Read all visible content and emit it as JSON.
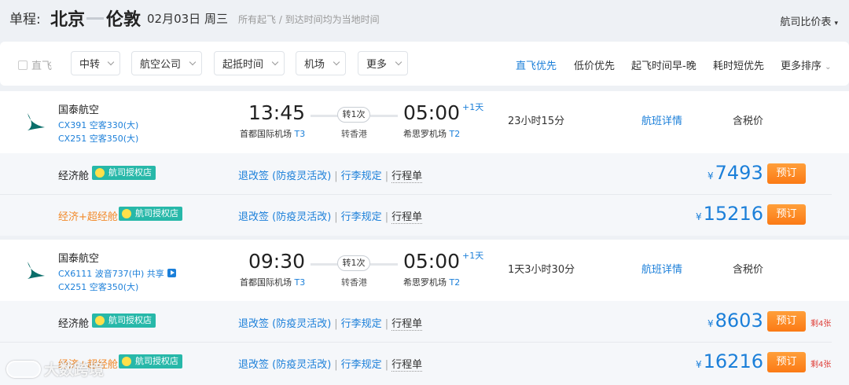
{
  "header": {
    "trip_type": "单程:",
    "from": "北京",
    "to": "伦敦",
    "date": "02月03日 周三",
    "note": "所有起飞 / 到达时间均为当地时间",
    "compare": "航司比价表"
  },
  "filters": {
    "direct_label": "直飞",
    "dropdowns": [
      "中转",
      "航空公司",
      "起抵时间",
      "机场",
      "更多"
    ],
    "sorts": [
      "直飞优先",
      "低价优先",
      "起飞时间早-晚",
      "耗时短优先",
      "更多排序"
    ],
    "active_sort": "直飞优先"
  },
  "flights": [
    {
      "airline": "国泰航空",
      "leg1": "CX391 空客330(大)",
      "leg2": "CX251 空客350(大)",
      "dep_time": "13:45",
      "dep_airport": "首都国际机场",
      "dep_terminal": "T3",
      "stops": "转1次",
      "via": "转香港",
      "arr_time": "05:00",
      "arr_airport": "希思罗机场",
      "arr_terminal": "T2",
      "day_offset": "+1天",
      "duration": "23小时15分",
      "detail": "航班详情",
      "tax": "含税价",
      "fares": [
        {
          "cabin": "经济舱",
          "badge": "航司授权店",
          "rule1": "退改签 (防疫灵活改)",
          "rule2": "行李规定",
          "rule3": "行程单",
          "yen": "¥",
          "price": "7493",
          "book": "预订",
          "left": ""
        },
        {
          "cabin": "经济+超经舱",
          "badge": "航司授权店",
          "rule1": "退改签 (防疫灵活改)",
          "rule2": "行李规定",
          "rule3": "行程单",
          "yen": "¥",
          "price": "15216",
          "book": "预订",
          "left": ""
        }
      ]
    },
    {
      "airline": "国泰航空",
      "leg1": "CX6111 波音737(中)",
      "leg1_share": "共享",
      "leg2": "CX251 空客350(大)",
      "dep_time": "09:30",
      "dep_airport": "首都国际机场",
      "dep_terminal": "T3",
      "stops": "转1次",
      "via": "转香港",
      "arr_time": "05:00",
      "arr_airport": "希思罗机场",
      "arr_terminal": "T2",
      "day_offset": "+1天",
      "duration": "1天3小时30分",
      "detail": "航班详情",
      "tax": "含税价",
      "fares": [
        {
          "cabin": "经济舱",
          "badge": "航司授权店",
          "rule1": "退改签 (防疫灵活改)",
          "rule2": "行李规定",
          "rule3": "行程单",
          "yen": "¥",
          "price": "8603",
          "book": "预订",
          "left": "剩4张"
        },
        {
          "cabin": "经济+超经舱",
          "badge": "航司授权店",
          "rule1": "退改签 (防疫灵活改)",
          "rule2": "行李规定",
          "rule3": "行程单",
          "yen": "¥",
          "price": "16216",
          "book": "预订",
          "left": "剩4张"
        }
      ]
    }
  ],
  "watermark": "大数跨境",
  "colors": {
    "accent": "#1b7fd9",
    "book": "#fb7a15",
    "badge": "#27b8a9",
    "cabin_upgrade": "#f28a2a",
    "left_tickets": "#e0413b"
  }
}
